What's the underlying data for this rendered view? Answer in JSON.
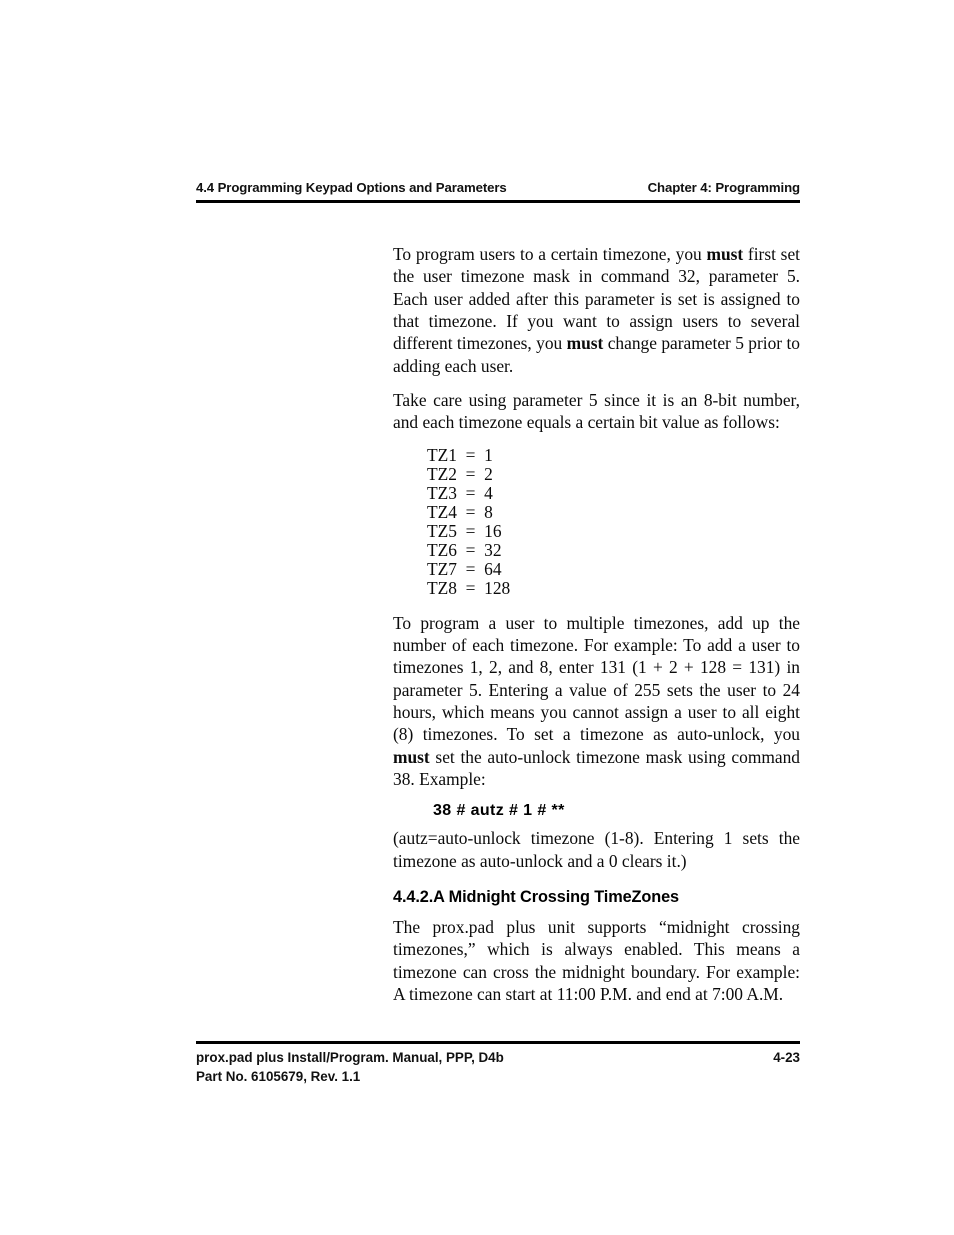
{
  "header": {
    "left": "4.4 Programming Keypad Options and Parameters",
    "right": "Chapter 4: Programming"
  },
  "body": {
    "paragraph_1": {
      "seg_1": "To program users to a certain timezone, you ",
      "bold_1": "must",
      "seg_2": " first set the user timezone mask in command 32, parameter 5. Each user added after this parameter is set is assigned to that timezone. If you want to assign users to several different timezones, you ",
      "bold_2": "must",
      "seg_3": " change parameter 5 prior to adding each user."
    },
    "paragraph_2": "Take care using parameter 5 since it is an 8-bit number, and each timezone equals a certain bit value as follows:",
    "timezone_values": [
      "TZ1  =  1",
      "TZ2  =  2",
      "TZ3  =  4",
      "TZ4  =  8",
      "TZ5  =  16",
      "TZ6  =  32",
      "TZ7  =  64",
      "TZ8  =  128"
    ],
    "paragraph_3": {
      "seg_1": "To program a user to multiple timezones, add up the number of each timezone. For example:  To add a user to timezones 1, 2, and 8, enter 131 (1 + 2 + 128 = 131) in parameter 5. Entering a value of 255 sets the user to 24 hours, which means you cannot assign a user to all eight (8) timezones. To set a timezone as auto-unlock, you ",
      "bold_1": "must",
      "seg_2": " set the auto-unlock timezone mask using command 38. Example:"
    },
    "command_example": "38 # autz # 1 # **",
    "paragraph_4": "(autz=auto-unlock timezone (1-8). Entering 1 sets the timezone as auto-unlock and a 0 clears it.)",
    "subsection_heading": "4.4.2.A Midnight Crossing TimeZones",
    "paragraph_5": "The prox.pad plus unit supports “midnight crossing timezones,” which is always enabled.  This means a timezone can cross the midnight boundary. For example:  A timezone can start at 11:00 P.M. and end at 7:00 A.M."
  },
  "footer": {
    "line_1": "prox.pad plus Install/Program. Manual, PPP, D4b",
    "line_2": "Part No. 6105679, Rev. 1.1",
    "page_number": "4-23"
  }
}
